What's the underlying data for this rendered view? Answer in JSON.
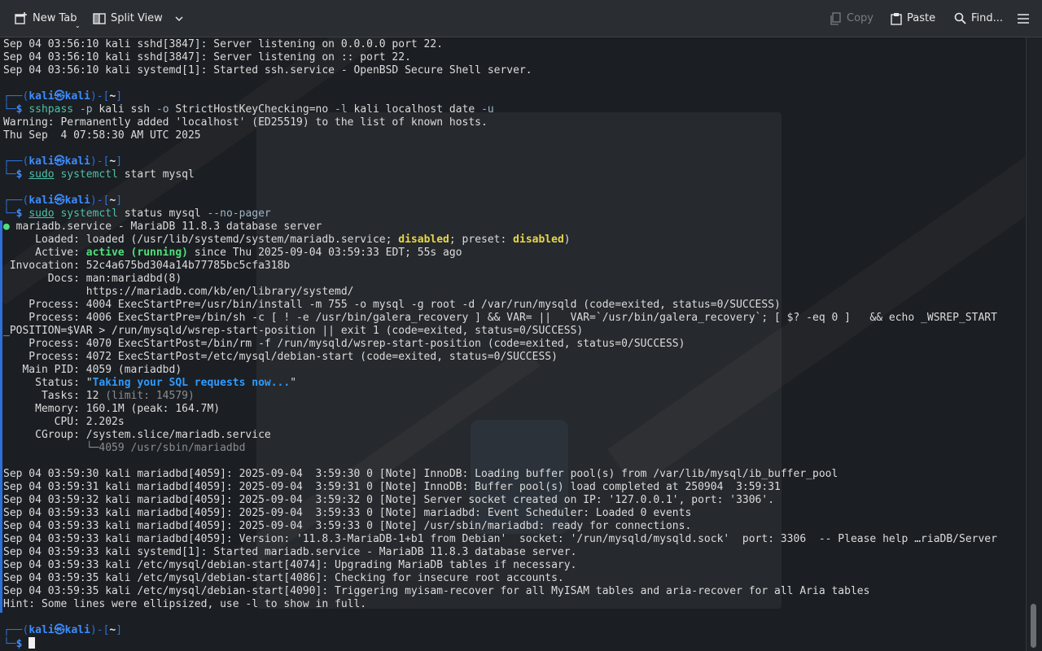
{
  "toolbar": {
    "new_tab": "New Tab",
    "split_view": "Split View",
    "copy": "Copy",
    "paste": "Paste",
    "find": "Find..."
  },
  "terminal": {
    "lines": [
      [
        {
          "t": "Sep 04 03:56:10 kali sshd[3847]: Server listening on 0.0.0.0 port 22."
        }
      ],
      [
        {
          "t": "Sep 04 03:56:10 kali sshd[3847]: Server listening on :: port 22."
        }
      ],
      [
        {
          "t": "Sep 04 03:56:10 kali systemd[1]: Started ssh.service - OpenBSD Secure Shell server."
        }
      ],
      [],
      [
        {
          "t": "┌──(",
          "c": "p-frame"
        },
        {
          "t": "kali㉿kali",
          "c": "p-user"
        },
        {
          "t": ")-[",
          "c": "p-frame"
        },
        {
          "t": "~",
          "c": "p-dir"
        },
        {
          "t": "]",
          "c": "p-frame"
        }
      ],
      [
        {
          "t": "└─",
          "c": "p-frame"
        },
        {
          "t": "$ ",
          "c": "p-user"
        },
        {
          "t": "sshpass",
          "c": "c-cmd"
        },
        {
          "t": " -p ",
          "c": "c-flag"
        },
        {
          "t": "kali ssh ",
          "c": "c-arg"
        },
        {
          "t": "-o ",
          "c": "c-flag"
        },
        {
          "t": "StrictHostKeyChecking=no ",
          "c": "c-arg"
        },
        {
          "t": "-l ",
          "c": "c-flag"
        },
        {
          "t": "kali localhost date ",
          "c": "c-arg"
        },
        {
          "t": "-u",
          "c": "c-flag"
        }
      ],
      [
        {
          "t": "Warning: Permanently added 'localhost' (ED25519) to the list of known hosts."
        }
      ],
      [
        {
          "t": "Thu Sep  4 07:58:30 AM UTC 2025"
        }
      ],
      [],
      [
        {
          "t": "┌──(",
          "c": "p-frame"
        },
        {
          "t": "kali㉿kali",
          "c": "p-user"
        },
        {
          "t": ")-[",
          "c": "p-frame"
        },
        {
          "t": "~",
          "c": "p-dir"
        },
        {
          "t": "]",
          "c": "p-frame"
        }
      ],
      [
        {
          "t": "└─",
          "c": "p-frame"
        },
        {
          "t": "$ ",
          "c": "p-user"
        },
        {
          "t": "sudo",
          "c": "c-sudo"
        },
        {
          "t": " systemctl",
          "c": "c-cmd"
        },
        {
          "t": " start mysql",
          "c": "c-arg"
        }
      ],
      [],
      [
        {
          "t": "┌──(",
          "c": "p-frame"
        },
        {
          "t": "kali㉿kali",
          "c": "p-user"
        },
        {
          "t": ")-[",
          "c": "p-frame"
        },
        {
          "t": "~",
          "c": "p-dir"
        },
        {
          "t": "]",
          "c": "p-frame"
        }
      ],
      [
        {
          "t": "└─",
          "c": "p-frame"
        },
        {
          "t": "$ ",
          "c": "p-user"
        },
        {
          "t": "sudo",
          "c": "c-sudo"
        },
        {
          "t": " systemctl",
          "c": "c-cmd"
        },
        {
          "t": " status mysql ",
          "c": "c-arg"
        },
        {
          "t": "--no-pager",
          "c": "c-flag"
        }
      ],
      [
        {
          "t": "●",
          "c": "dot"
        },
        {
          "t": " mariadb.service - MariaDB 11.8.3 database server"
        }
      ],
      [
        {
          "t": "     Loaded: loaded (/usr/lib/systemd/system/mariadb.service; "
        },
        {
          "t": "disabled",
          "c": "k-yellow"
        },
        {
          "t": "; preset: "
        },
        {
          "t": "disabled",
          "c": "k-yellow"
        },
        {
          "t": ")"
        }
      ],
      [
        {
          "t": "     Active: "
        },
        {
          "t": "active (running)",
          "c": "k-green"
        },
        {
          "t": " since Thu 2025-09-04 03:59:33 EDT; 55s ago"
        }
      ],
      [
        {
          "t": " Invocation: 52c4a675bd304a14b77785bc5cfa318b"
        }
      ],
      [
        {
          "t": "       Docs: man:mariadbd(8)"
        }
      ],
      [
        {
          "t": "             https://mariadb.com/kb/en/library/systemd/"
        }
      ],
      [
        {
          "t": "    Process: 4004 ExecStartPre=/usr/bin/install -m 755 -o mysql -g root -d /var/run/mysqld (code=exited, status=0/SUCCESS)"
        }
      ],
      [
        {
          "t": "    Process: 4006 ExecStartPre=/bin/sh -c [ ! -e /usr/bin/galera_recovery ] && VAR= ||   VAR=`/usr/bin/galera_recovery`; [ $? -eq 0 ]   && echo _WSREP_START"
        }
      ],
      [
        {
          "t": "_POSITION=$VAR > /run/mysqld/wsrep-start-position || exit 1 (code=exited, status=0/SUCCESS)"
        }
      ],
      [
        {
          "t": "    Process: 4070 ExecStartPost=/bin/rm -f /run/mysqld/wsrep-start-position (code=exited, status=0/SUCCESS)"
        }
      ],
      [
        {
          "t": "    Process: 4072 ExecStartPost=/etc/mysql/debian-start (code=exited, status=0/SUCCESS)"
        }
      ],
      [
        {
          "t": "   Main PID: 4059 (mariadbd)"
        }
      ],
      [
        {
          "t": "     Status: \""
        },
        {
          "t": "Taking your SQL requests now...",
          "c": "k-blue"
        },
        {
          "t": "\""
        }
      ],
      [
        {
          "t": "      Tasks: 12 "
        },
        {
          "t": "(limit: 14579)",
          "c": "k-gray"
        }
      ],
      [
        {
          "t": "     Memory: 160.1M (peak: 164.7M)"
        }
      ],
      [
        {
          "t": "        CPU: 2.202s"
        }
      ],
      [
        {
          "t": "     CGroup: /system.slice/mariadb.service"
        }
      ],
      [
        {
          "t": "             └─4059 /usr/sbin/mariadbd",
          "c": "k-gray"
        }
      ],
      [],
      [
        {
          "t": "Sep 04 03:59:30 kali mariadbd[4059]: 2025-09-04  3:59:30 0 [Note] InnoDB: Loading buffer pool(s) from /var/lib/mysql/ib_buffer_pool"
        }
      ],
      [
        {
          "t": "Sep 04 03:59:31 kali mariadbd[4059]: 2025-09-04  3:59:31 0 [Note] InnoDB: Buffer pool(s) load completed at 250904  3:59:31"
        }
      ],
      [
        {
          "t": "Sep 04 03:59:32 kali mariadbd[4059]: 2025-09-04  3:59:32 0 [Note] Server socket created on IP: '127.0.0.1', port: '3306'."
        }
      ],
      [
        {
          "t": "Sep 04 03:59:33 kali mariadbd[4059]: 2025-09-04  3:59:33 0 [Note] mariadbd: Event Scheduler: Loaded 0 events"
        }
      ],
      [
        {
          "t": "Sep 04 03:59:33 kali mariadbd[4059]: 2025-09-04  3:59:33 0 [Note] /usr/sbin/mariadbd: ready for connections."
        }
      ],
      [
        {
          "t": "Sep 04 03:59:33 kali mariadbd[4059]: Version: '11.8.3-MariaDB-1+b1 from Debian'  socket: '/run/mysqld/mysqld.sock'  port: 3306  -- Please help …riaDB/Server"
        }
      ],
      [
        {
          "t": "Sep 04 03:59:33 kali systemd[1]: Started mariadb.service - MariaDB 11.8.3 database server."
        }
      ],
      [
        {
          "t": "Sep 04 03:59:33 kali /etc/mysql/debian-start[4074]: Upgrading MariaDB tables if necessary."
        }
      ],
      [
        {
          "t": "Sep 04 03:59:35 kali /etc/mysql/debian-start[4086]: Checking for insecure root accounts."
        }
      ],
      [
        {
          "t": "Sep 04 03:59:35 kali /etc/mysql/debian-start[4090]: Triggering myisam-recover for all MyISAM tables and aria-recover for all Aria tables"
        }
      ],
      [
        {
          "t": "Hint: Some lines were ellipsized, use -l to show in full."
        }
      ],
      [],
      [
        {
          "t": "┌──(",
          "c": "p-frame"
        },
        {
          "t": "kali㉿kali",
          "c": "p-user"
        },
        {
          "t": ")-[",
          "c": "p-frame"
        },
        {
          "t": "~",
          "c": "p-dir"
        },
        {
          "t": "]",
          "c": "p-frame"
        }
      ],
      [
        {
          "t": "└─",
          "c": "p-frame"
        },
        {
          "t": "$ ",
          "c": "p-user"
        },
        {
          "cursor": true
        }
      ]
    ]
  },
  "colors": {
    "background": "#1b1e22",
    "prompt_frame": "#2e6fd8",
    "prompt_user": "#3d8cff",
    "command": "#4ec0a8",
    "status_active": "#4ee07a",
    "status_disabled": "#e6d64a"
  },
  "icons": [
    "new-tab-icon",
    "split-view-icon",
    "chevron-down-icon",
    "copy-icon",
    "paste-icon",
    "search-icon",
    "hamburger-menu-icon"
  ]
}
